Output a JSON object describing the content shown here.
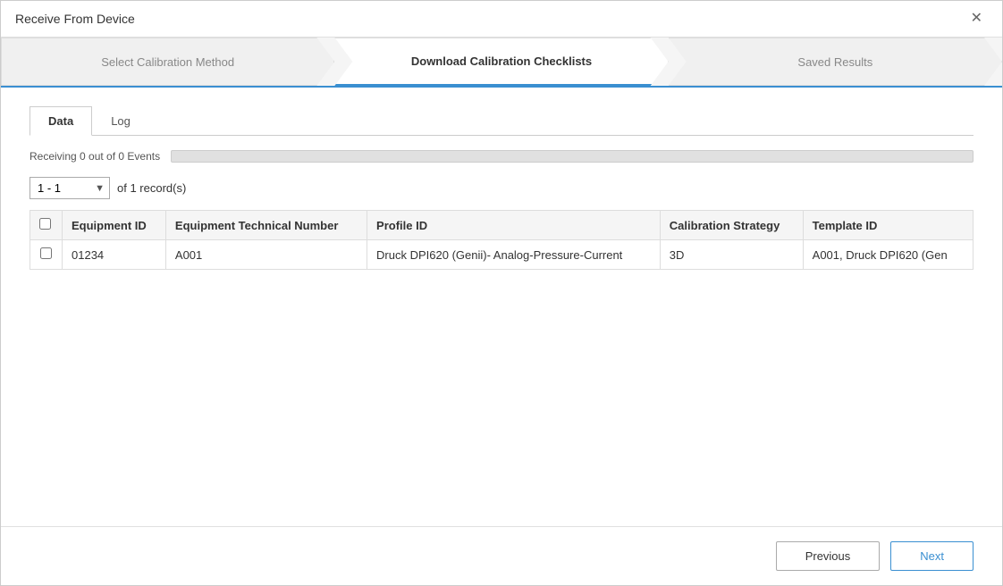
{
  "window": {
    "title": "Receive From Device"
  },
  "wizard": {
    "steps": [
      {
        "id": "select-method",
        "label": "Select Calibration Method",
        "state": "inactive"
      },
      {
        "id": "download-checklists",
        "label": "Download Calibration Checklists",
        "state": "active"
      },
      {
        "id": "saved-results",
        "label": "Saved Results",
        "state": "inactive"
      }
    ]
  },
  "tabs": [
    {
      "id": "data",
      "label": "Data",
      "active": true
    },
    {
      "id": "log",
      "label": "Log",
      "active": false
    }
  ],
  "progress": {
    "label": "Receiving 0 out of 0 Events",
    "value": 0
  },
  "pagination": {
    "current_range": "1 - 1",
    "total_records_label": "of 1 record(s)"
  },
  "table": {
    "columns": [
      {
        "id": "checkbox",
        "label": ""
      },
      {
        "id": "equipment-id",
        "label": "Equipment ID"
      },
      {
        "id": "equipment-technical-number",
        "label": "Equipment Technical Number"
      },
      {
        "id": "profile-id",
        "label": "Profile ID"
      },
      {
        "id": "calibration-strategy",
        "label": "Calibration Strategy"
      },
      {
        "id": "template-id",
        "label": "Template ID"
      }
    ],
    "rows": [
      {
        "equipment_id": "01234",
        "equipment_technical_number": "A001",
        "profile_id": "Druck DPI620 (Genii)- Analog-Pressure-Current",
        "calibration_strategy": "3D",
        "template_id": "A001, Druck DPI620 (Gen"
      }
    ]
  },
  "footer": {
    "previous_label": "Previous",
    "next_label": "Next"
  }
}
